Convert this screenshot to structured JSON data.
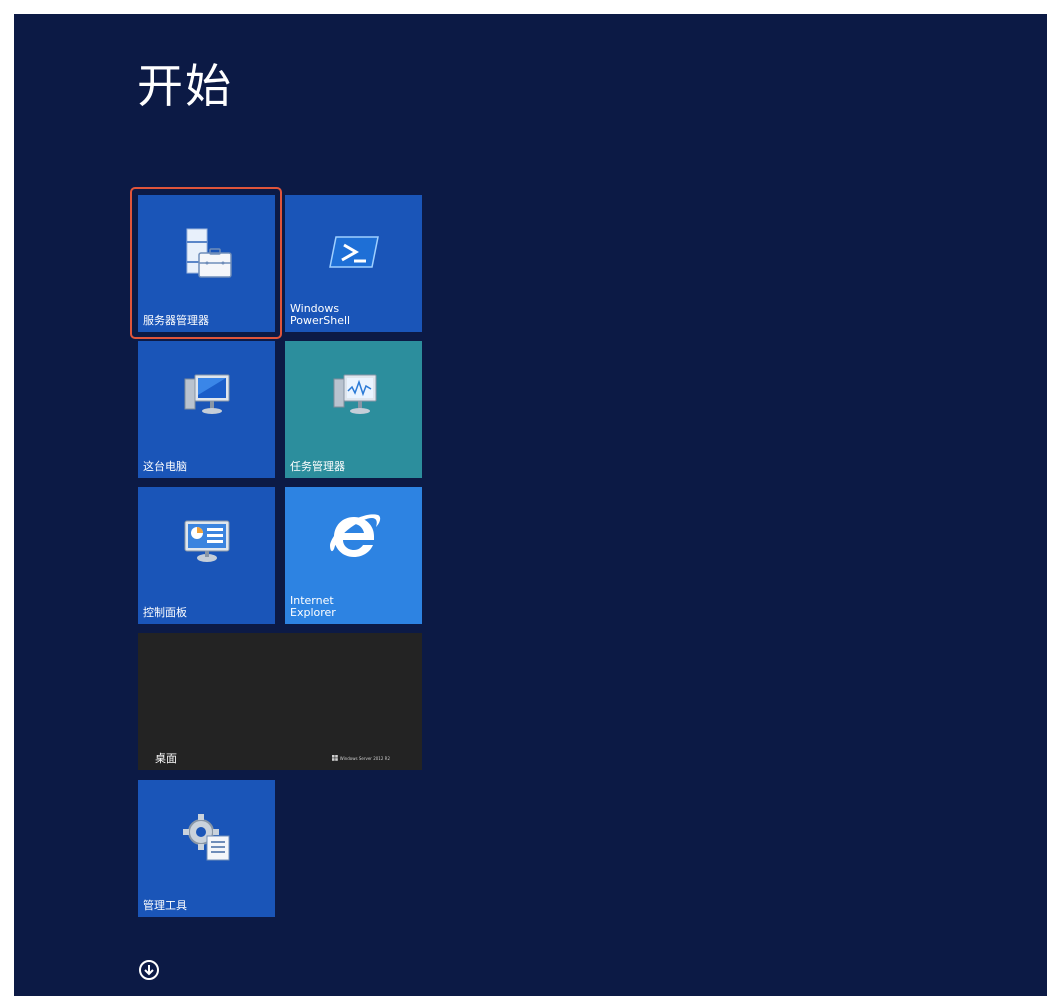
{
  "start": {
    "title": "开始"
  },
  "tiles": [
    {
      "id": "server-manager",
      "label": "服务器管理器",
      "color": "#1a55b8",
      "icon": "server-manager-icon",
      "highlighted": true
    },
    {
      "id": "powershell",
      "label": "Windows\nPowerShell",
      "color": "#1a55b8",
      "icon": "powershell-icon"
    },
    {
      "id": "this-pc",
      "label": "这台电脑",
      "color": "#1a55b8",
      "icon": "computer-icon"
    },
    {
      "id": "task-manager",
      "label": "任务管理器",
      "color": "#2c8e9d",
      "icon": "task-manager-icon"
    },
    {
      "id": "control-panel",
      "label": "控制面板",
      "color": "#1a55b8",
      "icon": "control-panel-icon"
    },
    {
      "id": "internet-explorer",
      "label": "Internet\nExplorer",
      "color": "#2d83e2",
      "icon": "internet-explorer-icon"
    },
    {
      "id": "desktop",
      "label": "桌面",
      "color": "#232323",
      "brand": "Windows Server 2012 R2"
    },
    {
      "id": "admin-tools",
      "label": "管理工具",
      "color": "#1a55b8",
      "icon": "admin-tools-icon"
    }
  ],
  "highlight_color": "#e0553b",
  "apps_button": {
    "icon": "down-arrow-circle-icon"
  }
}
